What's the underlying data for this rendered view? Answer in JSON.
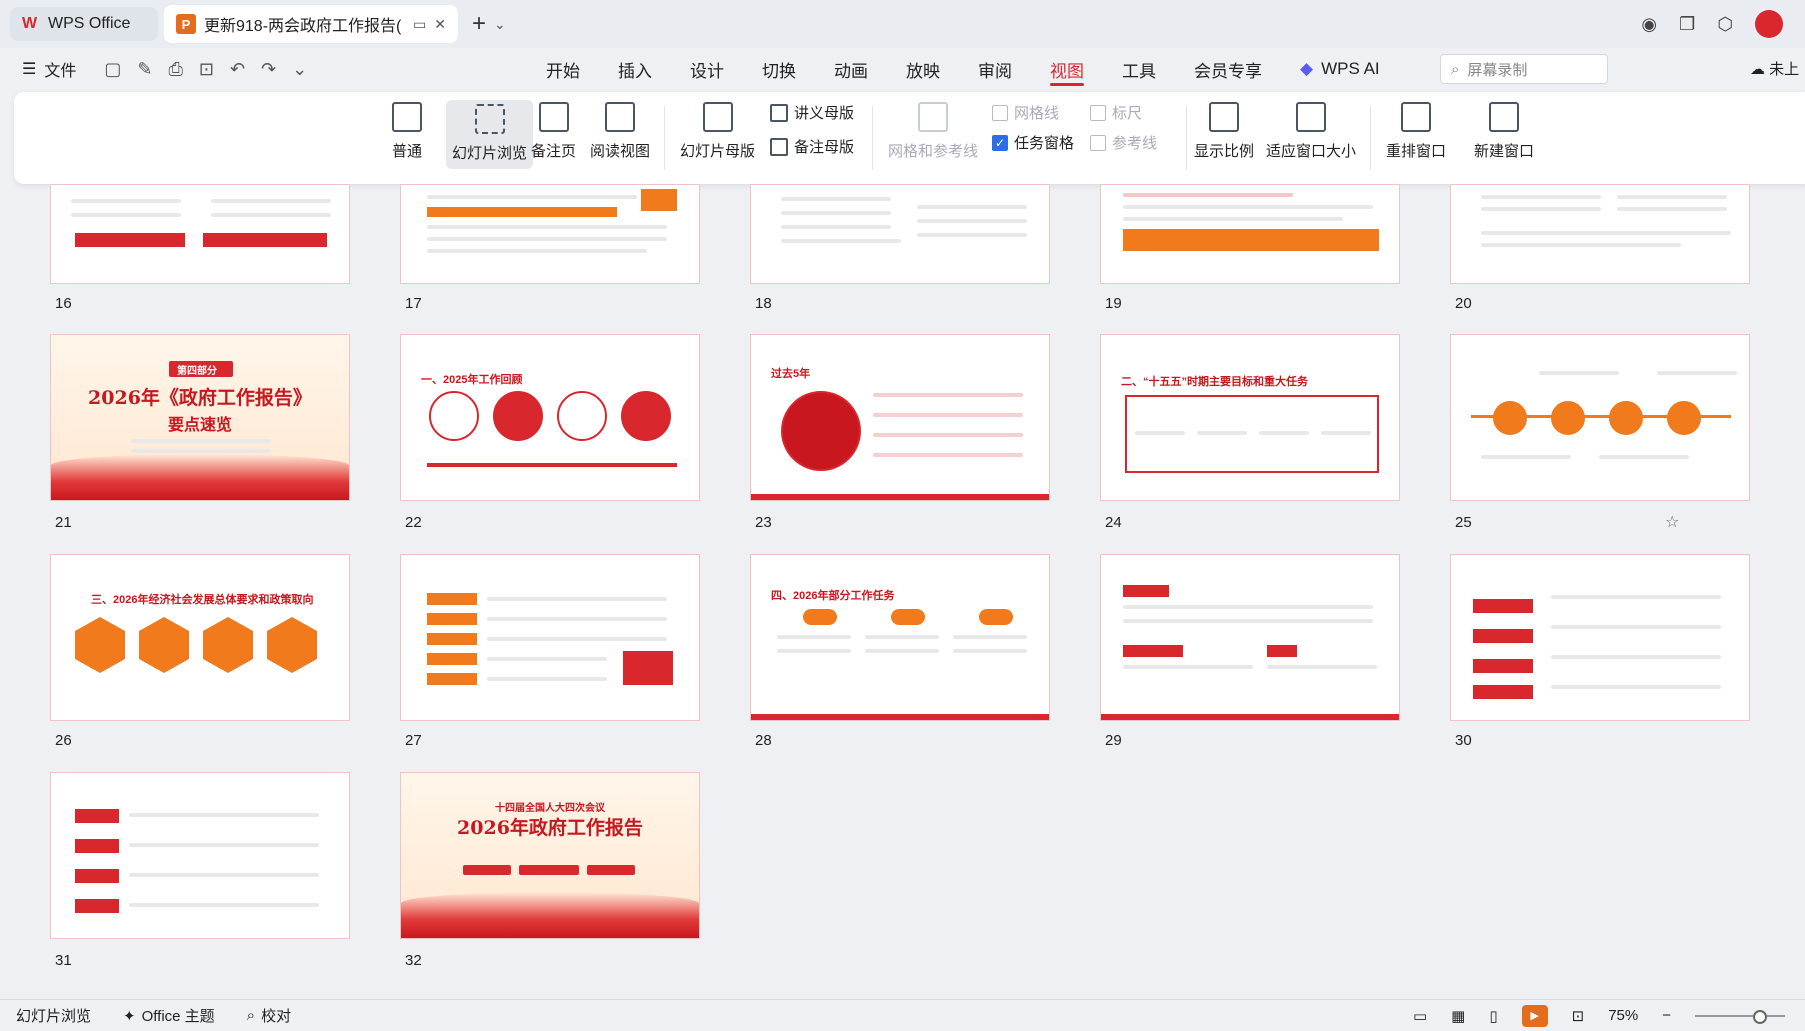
{
  "titlebar": {
    "home_tab": "WPS Office",
    "doc_tab": "更新918-两会政府工作报告(",
    "close_glyph": "✕",
    "plus_glyph": "+"
  },
  "menubar": {
    "file_label": "文件",
    "tabs": [
      "开始",
      "插入",
      "设计",
      "切换",
      "动画",
      "放映",
      "审阅",
      "视图",
      "工具",
      "会员专享"
    ],
    "active_tab": "视图",
    "wps_ai": "WPS AI",
    "search_placeholder": "屏幕录制",
    "cloud_label": "未上"
  },
  "ribbon": {
    "normal": "普通",
    "slide_browse": "幻灯片浏览",
    "notes_page": "备注页",
    "reading_view": "阅读视图",
    "slide_master": "幻灯片母版",
    "handout_master": "讲义母版",
    "notes_master": "备注母版",
    "grid_guides": "网格和参考线",
    "gridlines": "网格线",
    "ruler": "标尺",
    "task_pane": "任务窗格",
    "guides": "参考线",
    "zoom_ratio": "显示比例",
    "fit_window": "适应窗口大小",
    "arrange_window": "重排窗口",
    "new_window": "新建窗口"
  },
  "slides": {
    "numbers": [
      "16",
      "17",
      "18",
      "19",
      "20",
      "21",
      "22",
      "23",
      "24",
      "25",
      "26",
      "27",
      "28",
      "29",
      "30",
      "31",
      "32"
    ],
    "s21_part": "第四部分",
    "s21_title": "2026年《政府工作报告》",
    "s21_sub": "要点速览",
    "s22_title": "一、2025年工作回顾",
    "s23_title": "过去5年",
    "s24_title": "二、“十五五”时期主要目标和重大任务",
    "s26_title": "三、2026年经济社会发展总体要求和政策取向",
    "s28_title": "四、2026年部分工作任务",
    "s32_title": "2026年政府工作报告",
    "s32_top": "十四届全国人大四次会议"
  },
  "statusbar": {
    "view": "幻灯片浏览",
    "theme": "Office 主题",
    "proof": "校对",
    "zoom": "75%"
  }
}
